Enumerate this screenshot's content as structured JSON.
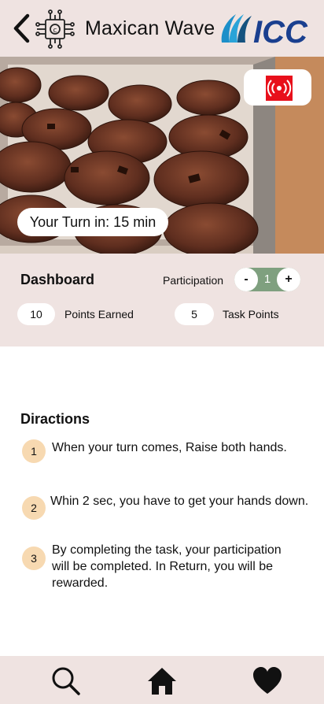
{
  "header": {
    "title": "Maxican Wave"
  },
  "hero": {
    "turn_text": "Your Turn in: 15 min"
  },
  "dashboard": {
    "title": "Dashboard",
    "participation_label": "Participation",
    "stepper": {
      "minus": "-",
      "value": "1",
      "plus": "+"
    },
    "points_earned_value": "10",
    "points_earned_label": "Points Earned",
    "task_points_value": "5",
    "task_points_label": "Task Points"
  },
  "directions": {
    "title": "Diractions",
    "steps": [
      {
        "num": "1",
        "text": "When your turn comes, Raise both hands."
      },
      {
        "num": "2",
        "text": "Whin 2 sec, you have to get your hands down."
      },
      {
        "num": "3",
        "text": "By completing the task, your participation will be completed. In Return, you will be rewarded."
      }
    ]
  },
  "colors": {
    "header_bg": "#efe3e1",
    "live_red": "#e8101b",
    "stepper_green": "#7fa07f",
    "badge_peach": "#f7d9b1"
  },
  "icons": [
    "chevron-left-icon",
    "circuit-chip-icon",
    "icc-logo",
    "live-broadcast-icon",
    "search-icon",
    "home-icon",
    "heart-icon"
  ]
}
